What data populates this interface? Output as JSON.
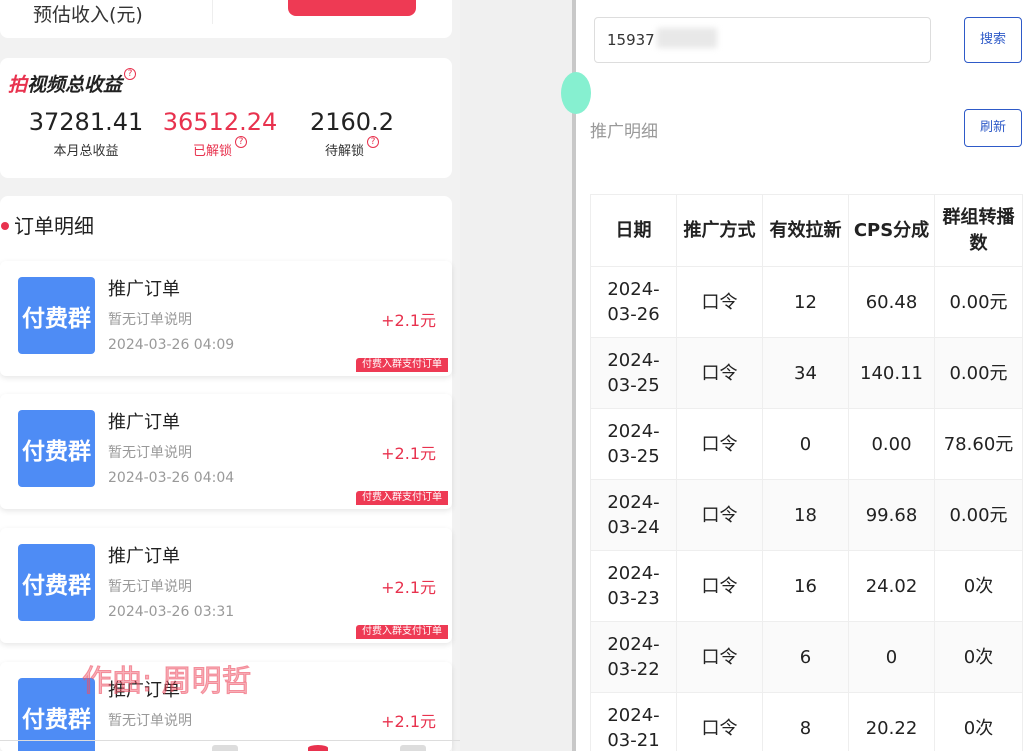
{
  "left": {
    "top": {
      "estimate_label": "预估收入(元)"
    },
    "earnings": {
      "title_red": "拍",
      "title_rest": "视频总收益",
      "help_glyph": "?",
      "stats": [
        {
          "value": "37281.41",
          "label": "本月总收益"
        },
        {
          "value": "36512.24",
          "label": "已解锁"
        },
        {
          "value": "2160.2",
          "label": "待解锁"
        }
      ]
    },
    "orders": {
      "title": "订单明细",
      "items": [
        {
          "badge": "付费群",
          "title": "推广订单",
          "desc": "暂无订单说明",
          "time": "2024-03-26 04:09",
          "amount": "+2.1元",
          "tag": "付费入群支付订单"
        },
        {
          "badge": "付费群",
          "title": "推广订单",
          "desc": "暂无订单说明",
          "time": "2024-03-26 04:04",
          "amount": "+2.1元",
          "tag": "付费入群支付订单"
        },
        {
          "badge": "付费群",
          "title": "推广订单",
          "desc": "暂无订单说明",
          "time": "2024-03-26 03:31",
          "amount": "+2.1元",
          "tag": "付费入群支付订单"
        },
        {
          "badge": "付费群",
          "title": "推广订单",
          "desc": "暂无订单说明",
          "time": "",
          "amount": "+2.1元",
          "tag": ""
        }
      ]
    },
    "watermark": "作曲: 周明哲"
  },
  "right": {
    "search": {
      "value": "15937",
      "button": "搜索"
    },
    "section_title": "推广明细",
    "refresh_button": "刷新",
    "table": {
      "headers": [
        "日期",
        "推广方式",
        "有效拉新",
        "CPS分成",
        "群组转播数"
      ],
      "rows": [
        [
          "2024-03-26",
          "口令",
          "12",
          "60.48",
          "0.00元"
        ],
        [
          "2024-03-25",
          "口令",
          "34",
          "140.11",
          "0.00元"
        ],
        [
          "2024-03-25",
          "口令",
          "0",
          "0.00",
          "78.60元"
        ],
        [
          "2024-03-24",
          "口令",
          "18",
          "99.68",
          "0.00元"
        ],
        [
          "2024-03-23",
          "口令",
          "16",
          "24.02",
          "0次"
        ],
        [
          "2024-03-22",
          "口令",
          "6",
          "0",
          "0次"
        ],
        [
          "2024-03-21",
          "口令",
          "8",
          "20.22",
          "0次"
        ]
      ]
    }
  },
  "colors": {
    "accent_red": "#e8324e",
    "badge_blue": "#4e8cf5",
    "button_blue": "#2e5ac8"
  }
}
